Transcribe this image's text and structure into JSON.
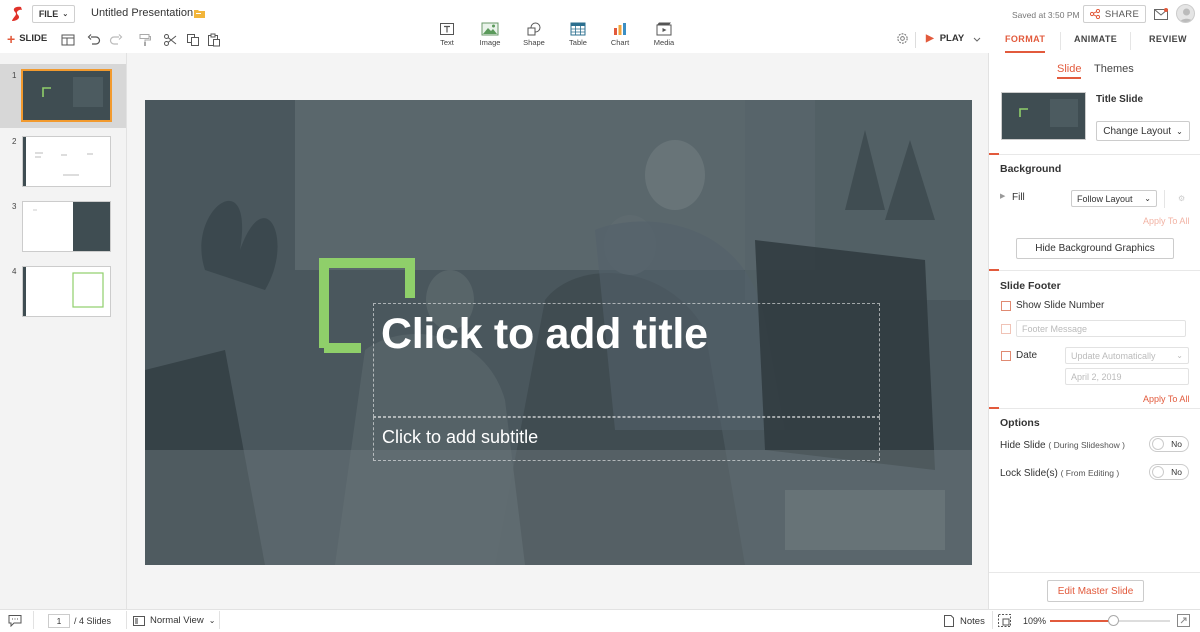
{
  "top": {
    "file_label": "FILE",
    "doc_title": "Untitled Presentation",
    "saved_text": "Saved at 3:50 PM",
    "share_label": "SHARE"
  },
  "toolbar": {
    "add_slide_label": "SLIDE",
    "insert": [
      {
        "label": "Text",
        "icon": "text-icon"
      },
      {
        "label": "Image",
        "icon": "image-icon"
      },
      {
        "label": "Shape",
        "icon": "shape-icon"
      },
      {
        "label": "Table",
        "icon": "table-icon"
      },
      {
        "label": "Chart",
        "icon": "chart-icon"
      },
      {
        "label": "Media",
        "icon": "media-icon"
      }
    ],
    "play_label": "PLAY"
  },
  "right_tabs": [
    "FORMAT",
    "ANIMATE",
    "REVIEW"
  ],
  "slides": [
    "1",
    "2",
    "3",
    "4"
  ],
  "slide": {
    "title_placeholder": "Click to add title",
    "subtitle_placeholder": "Click to add subtitle"
  },
  "format": {
    "sub_tabs": [
      "Slide",
      "Themes"
    ],
    "layout_name": "Title Slide",
    "change_layout": "Change Layout",
    "background": {
      "title": "Background",
      "fill_label": "Fill",
      "fill_value": "Follow Layout",
      "apply_all": "Apply To All",
      "hide_bg_button": "Hide Background Graphics"
    },
    "footer": {
      "title": "Slide Footer",
      "show_slide_number": "Show Slide Number",
      "footer_message_placeholder": "Footer Message",
      "date_label": "Date",
      "date_mode": "Update Automatically",
      "date_value": "April 2, 2019",
      "apply_all": "Apply To All"
    },
    "options": {
      "title": "Options",
      "hide_slide": "Hide Slide",
      "hide_slide_note": "( During Slideshow )",
      "hide_slide_value": "No",
      "lock_slide": "Lock Slide(s)",
      "lock_slide_note": "( From Editing )",
      "lock_slide_value": "No"
    },
    "edit_master": "Edit Master Slide"
  },
  "status": {
    "current_page": "1",
    "total": "/  4 Slides",
    "view_mode": "Normal View",
    "notes": "Notes",
    "zoom": "109%"
  },
  "colors": {
    "accent": "#e25a3c",
    "slide_bg": "#4a575d",
    "bracket": "#8fcf6a",
    "selected_thumb_border": "#f29a2e"
  }
}
